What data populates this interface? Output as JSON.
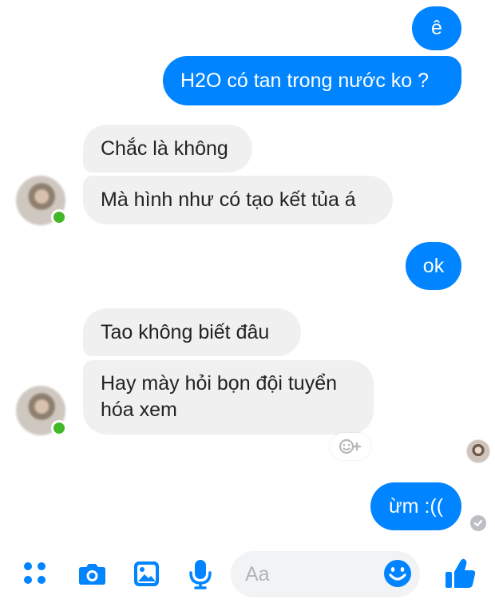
{
  "messages": [
    {
      "text": "ê",
      "direction": "outgoing"
    },
    {
      "text": "H2O có tan trong nước ko ?",
      "direction": "outgoing"
    },
    {
      "text": "Chắc là không",
      "direction": "incoming"
    },
    {
      "text": "Mà hình như có tạo kết tủa á",
      "direction": "incoming"
    },
    {
      "text": "ok",
      "direction": "outgoing"
    },
    {
      "text": "Tao không biết đâu",
      "direction": "incoming"
    },
    {
      "text": "Hay mày hỏi bọn đội tuyển",
      "direction": "incoming"
    },
    {
      "text": "hóa xem",
      "direction": "incoming"
    },
    {
      "text": "ừm :((",
      "direction": "outgoing"
    }
  ],
  "composer": {
    "placeholder": "Aa"
  },
  "icons": {
    "more": "grid-icon",
    "camera": "camera-icon",
    "gallery": "image-icon",
    "voice": "microphone-icon",
    "emoji": "smile-icon",
    "like": "thumbs-up-icon",
    "reaction": "add-reaction-icon",
    "sent": "checkmark-icon"
  },
  "colors": {
    "outgoing": "#0084ff",
    "incoming": "#f1f0f0",
    "online": "#42b72a",
    "icon": "#0084ff"
  }
}
